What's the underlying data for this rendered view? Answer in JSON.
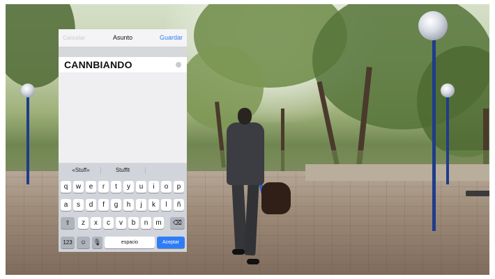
{
  "email_subject_editor": {
    "nav": {
      "cancel_label": "Cancelar",
      "title": "Asunto",
      "save_label": "Guardar"
    },
    "subject_value": "CANNBIANDO",
    "predictive_bar": [
      "«Stuff»",
      "Stufflt",
      ""
    ],
    "keyboard": {
      "row1": [
        "q",
        "w",
        "e",
        "r",
        "t",
        "y",
        "u",
        "i",
        "o",
        "p"
      ],
      "row2": [
        "a",
        "s",
        "d",
        "f",
        "g",
        "h",
        "j",
        "k",
        "l",
        "ñ"
      ],
      "row3": [
        "z",
        "x",
        "c",
        "v",
        "b",
        "n",
        "m"
      ],
      "numbers_label": "123",
      "space_label": "espacio",
      "accept_label": "Aceptar"
    },
    "colors": {
      "accent": "#2f7df6",
      "key_background": "#ffffff",
      "keyboard_background": "#d1d4da"
    },
    "icons": {
      "shift": "shift-icon",
      "backspace": "backspace-icon",
      "emoji": "emoji-icon",
      "microphone": "microphone-icon",
      "clear": "clear-field-icon"
    }
  }
}
